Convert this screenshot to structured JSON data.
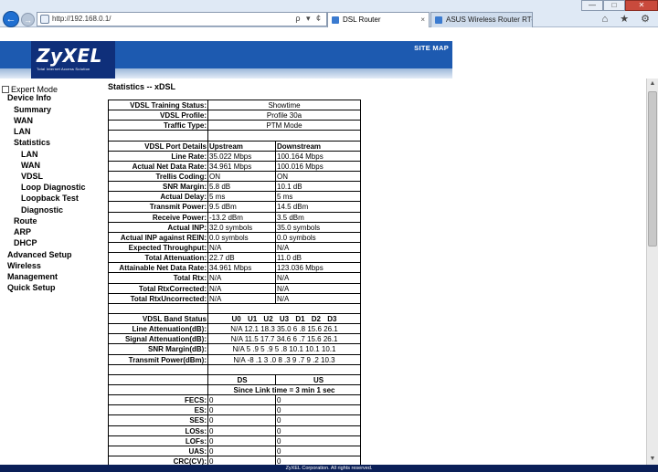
{
  "browser": {
    "address": "http://192.168.0.1/",
    "address_tools": "ρ ▾ ¢",
    "tabs": [
      {
        "label": "DSL Router",
        "active": true
      },
      {
        "label": "ASUS Wireless Router RT-AC...",
        "active": false
      }
    ],
    "tab_close": "×",
    "window_buttons": {
      "minimize": "—",
      "maximize": "□",
      "close": "✕"
    },
    "back_icon": "←",
    "forward_icon": "→",
    "command_icons": "⌂ ★ ⚙"
  },
  "banner": {
    "logo": "ZyXEL",
    "logo_sub": "Total Internet Access Solution",
    "site_map": "SITE MAP"
  },
  "sidebar": {
    "expert_mode": "Expert Mode",
    "items": [
      {
        "label": "Device Info",
        "level": 0
      },
      {
        "label": "Summary",
        "level": 1
      },
      {
        "label": "WAN",
        "level": 1
      },
      {
        "label": "LAN",
        "level": 1
      },
      {
        "label": "Statistics",
        "level": 1
      },
      {
        "label": "LAN",
        "level": 2
      },
      {
        "label": "WAN",
        "level": 2
      },
      {
        "label": "VDSL",
        "level": 2
      },
      {
        "label": "Loop Diagnostic",
        "level": 2
      },
      {
        "label": "Loopback Test",
        "level": 2
      },
      {
        "label": "Diagnostic",
        "level": 2
      },
      {
        "label": "Route",
        "level": 1
      },
      {
        "label": "ARP",
        "level": 1
      },
      {
        "label": "DHCP",
        "level": 1
      },
      {
        "label": "Advanced Setup",
        "level": 0
      },
      {
        "label": "Wireless",
        "level": 0
      },
      {
        "label": "Management",
        "level": 0
      },
      {
        "label": "Quick Setup",
        "level": 0
      }
    ]
  },
  "main": {
    "title": "Statistics -- xDSL",
    "status": {
      "training_label": "VDSL Training Status:",
      "training_value": "Showtime",
      "profile_label": "VDSL Profile:",
      "profile_value": "Profile 30a",
      "traffic_label": "Traffic Type:",
      "traffic_value": "PTM Mode"
    },
    "port": {
      "header": "VDSL Port Details",
      "up_header": "Upstream",
      "down_header": "Downstream",
      "rows": [
        {
          "label": "Line Rate:",
          "up": "35.022 Mbps",
          "down": "100.164 Mbps"
        },
        {
          "label": "Actual Net Data Rate:",
          "up": "34.961 Mbps",
          "down": "100.016 Mbps"
        },
        {
          "label": "Trellis Coding:",
          "up": "ON",
          "down": "ON"
        },
        {
          "label": "SNR Margin:",
          "up": "5.8 dB",
          "down": "10.1 dB"
        },
        {
          "label": "Actual Delay:",
          "up": "5 ms",
          "down": "5 ms"
        },
        {
          "label": "Transmit Power:",
          "up": "9.5 dBm",
          "down": "14.5 dBm"
        },
        {
          "label": "Receive Power:",
          "up": "-13.2 dBm",
          "down": "3.5 dBm"
        },
        {
          "label": "Actual INP:",
          "up": "32.0 symbols",
          "down": "35.0 symbols"
        },
        {
          "label": "Actual INP against REIN:",
          "up": "0.0 symbols",
          "down": "0.0 symbols"
        },
        {
          "label": "Expected Throughput:",
          "up": "N/A",
          "down": "N/A"
        },
        {
          "label": "Total Attenuation:",
          "up": "22.7 dB",
          "down": "11.0 dB"
        },
        {
          "label": "Attainable Net Data Rate:",
          "up": "34.961 Mbps",
          "down": "123.036 Mbps"
        },
        {
          "label": "Total Rtx:",
          "up": "N/A",
          "down": "N/A"
        },
        {
          "label": "Total RtxCorrected:",
          "up": "N/A",
          "down": "N/A"
        },
        {
          "label": "Total RtxUncorrected:",
          "up": "N/A",
          "down": "N/A"
        }
      ]
    },
    "band": {
      "header": "VDSL Band Status",
      "columns": "U0 U1 U2 U3 D1 D2 D3",
      "rows": [
        {
          "label": "Line Attenuation(dB):",
          "values": "N/A 12.1 18.3 35.0 6 .8 15.6 26.1"
        },
        {
          "label": "Signal Attenuation(dB):",
          "values": "N/A 11.5 17.7 34.6 6 .7 15.6 26.1"
        },
        {
          "label": "SNR Margin(dB):",
          "values": "N/A 5 .9 5 .9 5 .8 10.1 10.1 10.1"
        },
        {
          "label": "Transmit Power(dBm):",
          "values": "N/A -8 .1 3 .0 8 .3 9 .7 9 .2 10.3"
        }
      ]
    },
    "counters": {
      "ds_header": "DS",
      "us_header": "US",
      "since": "Since Link time = 3 min 1 sec",
      "rows": [
        {
          "label": "FECS:",
          "ds": "0",
          "us": "0"
        },
        {
          "label": "ES:",
          "ds": "0",
          "us": "0"
        },
        {
          "label": "SES:",
          "ds": "0",
          "us": "0"
        },
        {
          "label": "LOSs:",
          "ds": "0",
          "us": "0"
        },
        {
          "label": "LOFs:",
          "ds": "0",
          "us": "0"
        },
        {
          "label": "UAS:",
          "ds": "0",
          "us": "0"
        },
        {
          "label": "CRC(CV):",
          "ds": "0",
          "us": "0"
        }
      ]
    }
  },
  "footer": "ZyXEL Corporation. All rights reserved.",
  "scrollbar": {
    "up": "▲",
    "down": "▼"
  }
}
